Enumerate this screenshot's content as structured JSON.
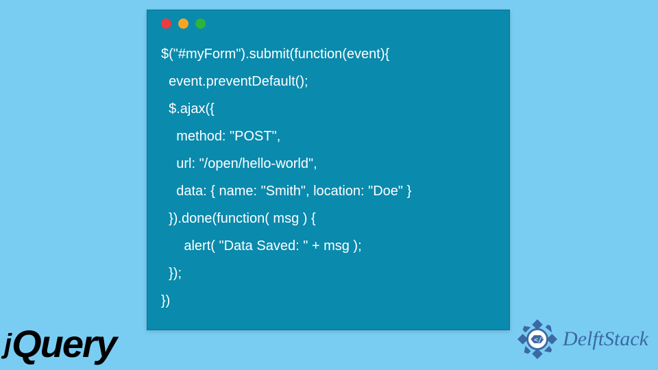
{
  "codeWindow": {
    "dots": [
      "close",
      "minimize",
      "zoom"
    ],
    "lines": [
      "$(\"#myForm\").submit(function(event){",
      "  event.preventDefault();",
      "  $.ajax({",
      "    method: \"POST\",",
      "    url: \"/open/hello-world\",",
      "    data: { name: \"Smith\", location: \"Doe\" }",
      "  }).done(function( msg ) {",
      "      alert( \"Data Saved: \" + msg );",
      "  });",
      "})"
    ]
  },
  "logos": {
    "jquery": {
      "prefix": "j",
      "main": "Query"
    },
    "delft": {
      "text": "DelftStack",
      "iconLabel": "delftstack-logo"
    }
  },
  "colors": {
    "pageBg": "#79cdf2",
    "codeBg": "#0a8aad",
    "codeFg": "#ffffff",
    "delftAccent": "#3b69a3"
  }
}
